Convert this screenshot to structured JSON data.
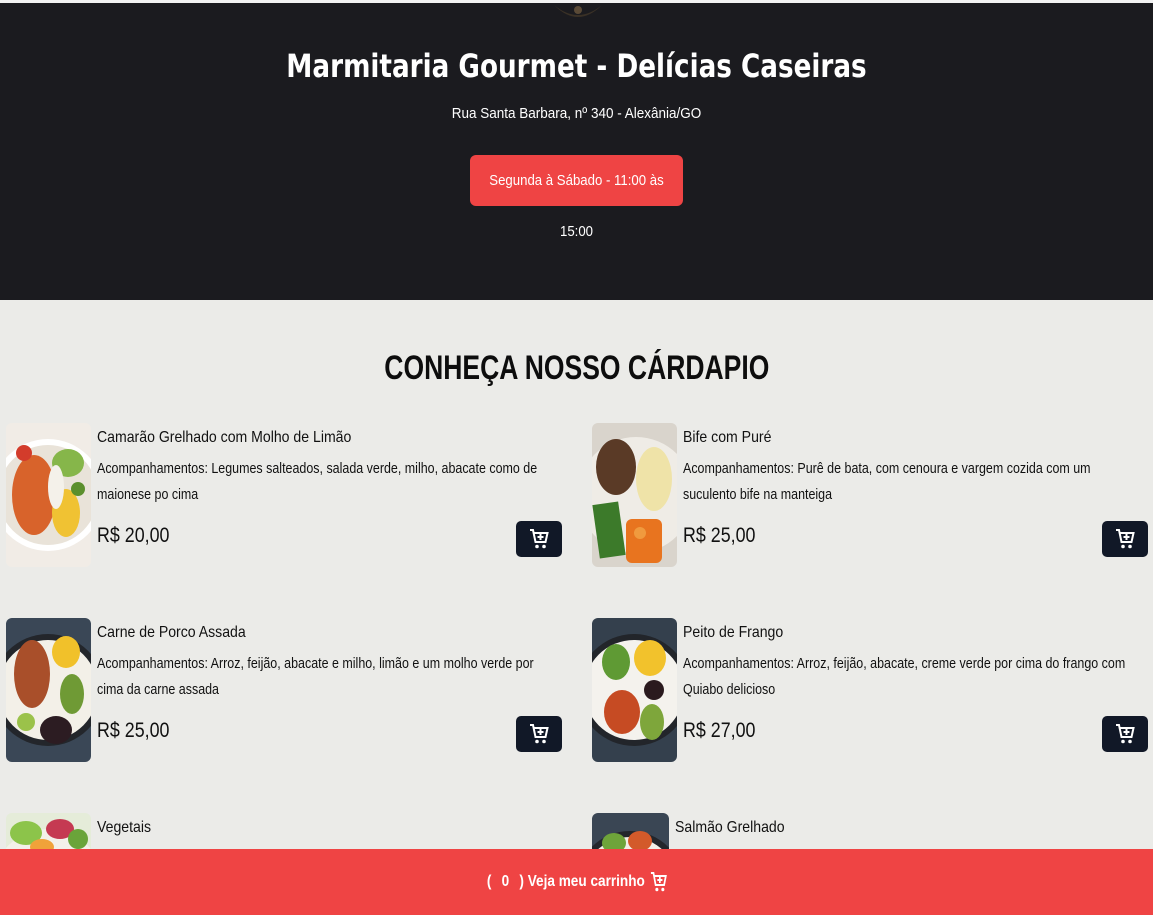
{
  "header": {
    "title": "Marmitaria Gourmet - Delícias Caseiras",
    "address": "Rua Santa Barbara, nº 340 - Alexânia/GO",
    "hours": "Segunda à Sábado - 11:00 às 15:00"
  },
  "menu": {
    "title": "CONHEÇA NOSSO CÁRDAPIO",
    "items": [
      {
        "name": "Camarão Grelhado com Molho de Limão",
        "description": "Acompanhamentos: Legumes salteados, salada verde, milho, abacate como de maionese po cima",
        "price": "R$ 20,00"
      },
      {
        "name": "Bife com Puré",
        "description": "Acompanhamentos: Purê de bata, com cenoura e vargem cozida com um suculento bife na manteiga",
        "price": "R$ 25,00"
      },
      {
        "name": "Carne de Porco Assada",
        "description": "Acompanhamentos: Arroz, feijão, abacate e milho, limão e um molho verde por cima da carne assada",
        "price": "R$ 25,00"
      },
      {
        "name": "Peito de Frango",
        "description": "Acompanhamentos: Arroz, feijão, abacate, creme verde por cima do frango com Quiabo delicioso",
        "price": "R$ 27,00"
      },
      {
        "name": "Vegetais",
        "description": "",
        "price": ""
      },
      {
        "name": "Salmão Grelhado",
        "description": "",
        "price": ""
      }
    ]
  },
  "cart": {
    "open_paren": "(",
    "count": "0",
    "label": ") Veja meu carrinho"
  },
  "colors": {
    "accent": "#ef4444",
    "hero_bg": "#1b1b1f",
    "page_bg": "#ebebe8",
    "button_dark": "#111827"
  },
  "icons": {
    "cart": "cart-plus-icon",
    "logo": "logo-icon"
  }
}
